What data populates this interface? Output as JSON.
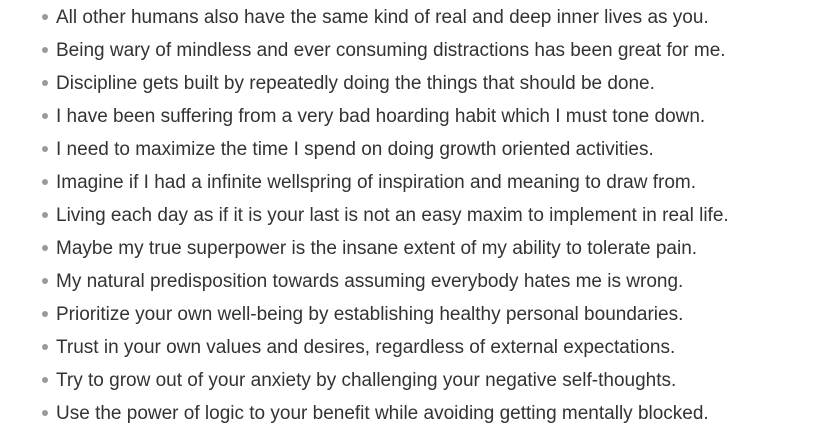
{
  "list": {
    "items": [
      "All other humans also have the same kind of real and deep inner lives as you.",
      "Being wary of mindless and ever consuming distractions has been great for me.",
      "Discipline gets built by repeatedly doing the things that should be done.",
      "I have been suffering from a very bad hoarding habit which I must tone down.",
      "I need to maximize the time I spend on doing growth oriented activities.",
      "Imagine if I had a infinite wellspring of inspiration and meaning to draw from.",
      "Living each day as if it is your last is not an easy maxim to implement in real life.",
      "Maybe my true superpower is the insane extent of my ability to tolerate pain.",
      "My natural predisposition towards assuming everybody hates me is wrong.",
      "Prioritize your own well-being by establishing healthy personal boundaries.",
      "Trust in your own values and desires, regardless of external expectations.",
      "Try to grow out of your anxiety by challenging your negative self-thoughts.",
      "Use the power of logic to your benefit while avoiding getting mentally blocked."
    ]
  },
  "colors": {
    "text": "#333333",
    "bullet": "#9a9a9a",
    "background": "#ffffff"
  }
}
